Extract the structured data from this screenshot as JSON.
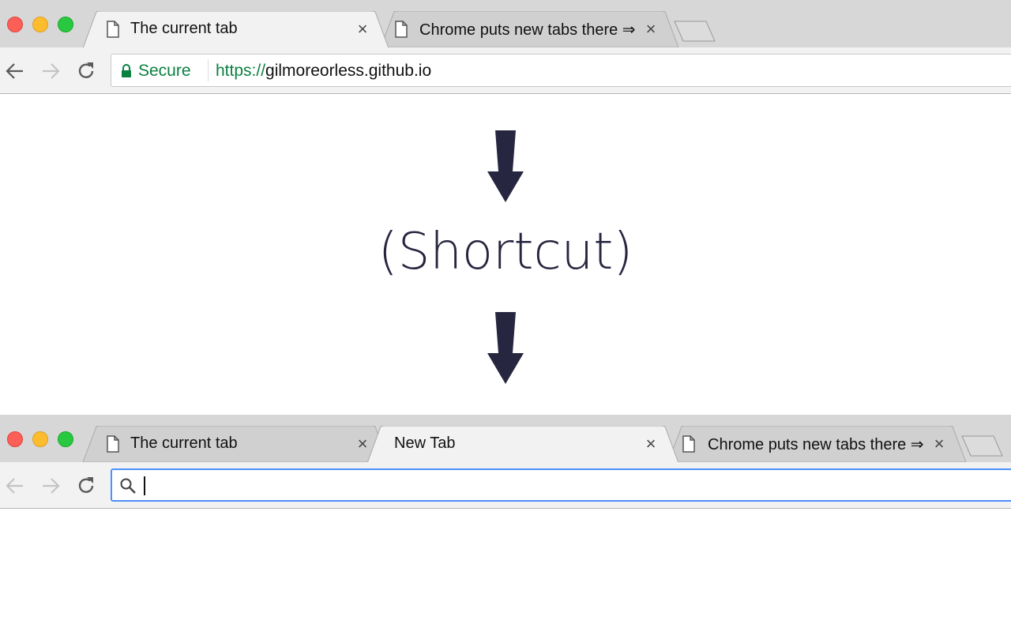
{
  "before": {
    "tabs": [
      {
        "title": "The current tab",
        "active": true
      },
      {
        "title": "Chrome puts new tabs there ⇒",
        "active": false
      }
    ],
    "omnibox": {
      "secure_label": "Secure",
      "scheme": "https://",
      "host": "gilmoreorless.github.io"
    }
  },
  "middle": {
    "label": "(Shortcut)"
  },
  "after": {
    "tabs": [
      {
        "title": "The current tab",
        "active": false
      },
      {
        "title": "New Tab",
        "active": true
      },
      {
        "title": "Chrome puts new tabs there ⇒",
        "active": false
      }
    ],
    "omnibox": {
      "value": ""
    }
  },
  "colors": {
    "arrow": "#272640",
    "secure": "#0b8043",
    "focus": "#4d90fe"
  }
}
